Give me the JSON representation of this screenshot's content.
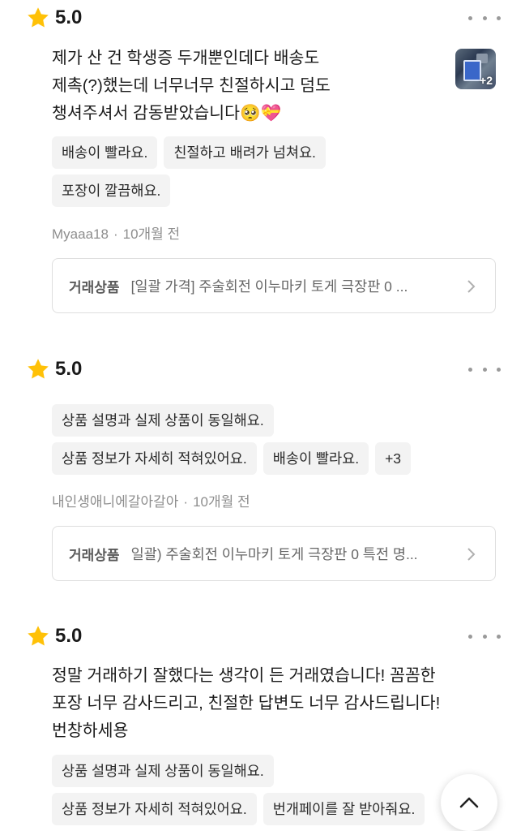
{
  "reviews": [
    {
      "score": "5.0",
      "text": "제가 산 건 학생증 두개뿐인데다 배송도\n제촉(?)했는데 너무너무 친절하시고 덤도\n챙셔주셔서 감동받았습니다🥺💝",
      "photo_more": "+2",
      "tags": [
        [
          "배송이 빨라요.",
          "친절하고 배려가 넘쳐요."
        ],
        [
          "포장이 깔끔해요."
        ]
      ],
      "author": "Myaaa18",
      "time": "10개월 전",
      "deal_label": "거래상품",
      "deal_title": "[일괄 가격] 주술회전 이누마키 토게 극장판 0 ..."
    },
    {
      "score": "5.0",
      "tags": [
        [
          "상품 설명과 실제 상품이 동일해요."
        ],
        [
          "상품 정보가 자세히 적혀있어요.",
          "배송이 빨라요.",
          "+3"
        ]
      ],
      "author": "내인생애니에갈아갈아",
      "time": "10개월 전",
      "deal_label": "거래상품",
      "deal_title": "일괄) 주술회전 이누마키 토게 극장판 0 특전 명..."
    },
    {
      "score": "5.0",
      "text": "정말 거래하기 잘했다는 생각이 든 거래였습니다! 꼼꼼한\n포장 너무 감사드리고, 친절한 답변도 너무 감사드립니다!\n번창하세용",
      "tags": [
        [
          "상품 설명과 실제 상품이 동일해요."
        ],
        [
          "상품 정보가 자세히 적혀있어요.",
          "번개페이를 잘 받아줘요."
        ]
      ]
    }
  ],
  "icons": {
    "rating": "star-icon",
    "menu": "more-dots-icon",
    "deal": "chevron-right-icon",
    "scroll": "chevron-up-icon"
  },
  "colors": {
    "star": "#FFC107",
    "chip_bg": "#F3F3F3",
    "meta_text": "#8E8E8E"
  }
}
